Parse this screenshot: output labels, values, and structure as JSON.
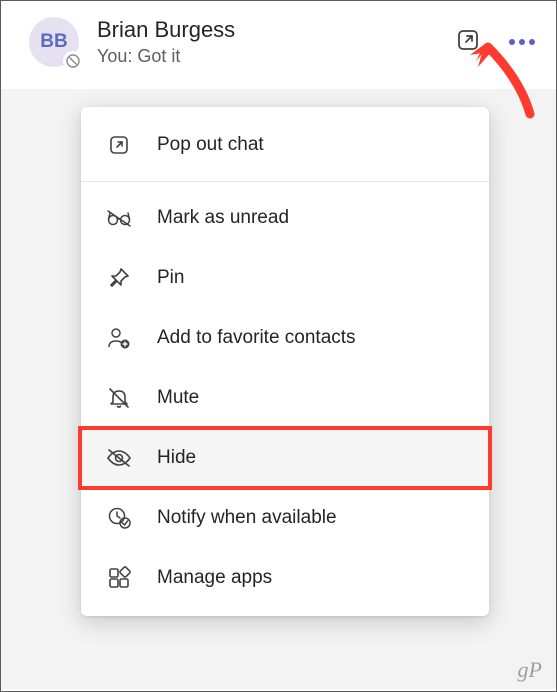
{
  "chat": {
    "avatar_initials": "BB",
    "contact_name": "Brian Burgess",
    "last_message": "You: Got it"
  },
  "menu": {
    "pop_out": "Pop out chat",
    "mark_unread": "Mark as unread",
    "pin": "Pin",
    "add_favorite": "Add to favorite contacts",
    "mute": "Mute",
    "hide": "Hide",
    "notify": "Notify when available",
    "manage_apps": "Manage apps"
  },
  "watermark": "gP"
}
